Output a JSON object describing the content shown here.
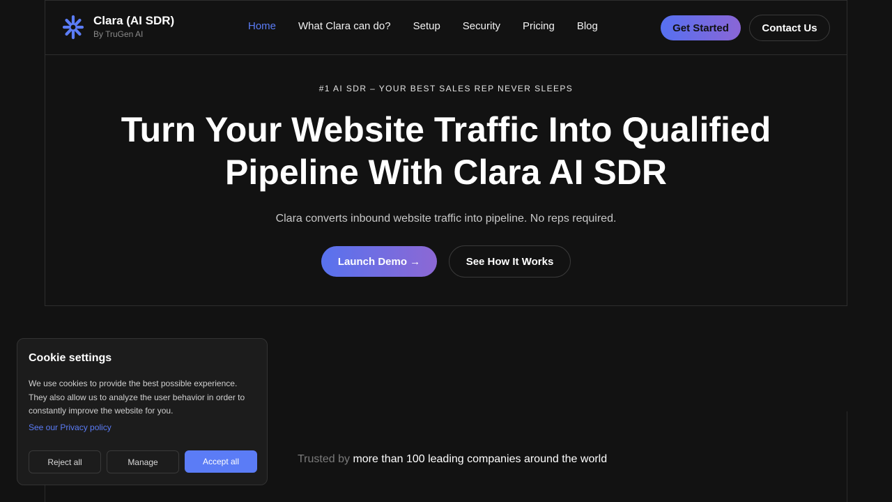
{
  "brand": {
    "name": "Clara (AI SDR)",
    "subtitle": "By TruGen AI",
    "logo_icon": "asterisk-logo-icon",
    "accent_color": "#5b7cf6"
  },
  "nav": {
    "links": [
      {
        "label": "Home",
        "active": true
      },
      {
        "label": "What Clara can do?",
        "active": false
      },
      {
        "label": "Setup",
        "active": false
      },
      {
        "label": "Security",
        "active": false
      },
      {
        "label": "Pricing",
        "active": false
      },
      {
        "label": "Blog",
        "active": false
      }
    ],
    "get_started": "Get Started",
    "contact_us": "Contact Us"
  },
  "hero": {
    "eyebrow": "#1 AI SDR – YOUR BEST SALES REP NEVER SLEEPS",
    "title_line1": "Turn Your Website Traffic Into Qualified",
    "title_line2": "Pipeline With Clara AI SDR",
    "subtitle": "Clara converts inbound website traffic into pipeline. No reps required.",
    "launch_demo": "Launch Demo →",
    "see_how": "See How It Works"
  },
  "trusted": {
    "muted": "Trusted by",
    "text": "more than 100 leading companies around the world"
  },
  "cookie": {
    "title": "Cookie settings",
    "text": "We use cookies to provide the best possible experience. They also allow us to analyze the user behavior in order to constantly improve the website for you.",
    "privacy_link": "See our Privacy policy",
    "reject": "Reject all",
    "manage": "Manage",
    "accept": "Accept all"
  }
}
